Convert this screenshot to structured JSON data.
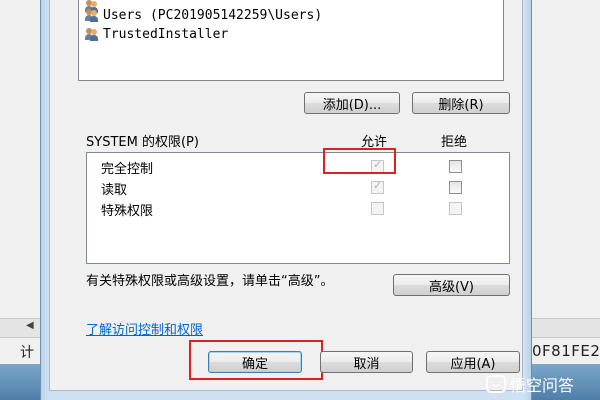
{
  "background": {
    "left_text": "计",
    "right_text": "0F81FE2"
  },
  "users": [
    {
      "name": "Users (PC201905142259\\Users)"
    },
    {
      "name": "TrustedInstaller"
    }
  ],
  "buttons": {
    "add": "添加(D)...",
    "remove": "删除(R)",
    "advanced": "高级(V)",
    "ok": "确定",
    "cancel": "取消",
    "apply": "应用(A)"
  },
  "permissions": {
    "title": "SYSTEM 的权限(P)",
    "allow_header": "允许",
    "deny_header": "拒绝",
    "rows": [
      {
        "label": "完全控制",
        "allow": true,
        "deny": false
      },
      {
        "label": "读取",
        "allow": true,
        "deny": false
      },
      {
        "label": "特殊权限",
        "allow": false,
        "deny": false
      }
    ]
  },
  "advanced_text": "有关特殊权限或高级设置，请单击“高级”。",
  "link_text": "了解访问控制和权限",
  "watermark": "悟空问答",
  "colors": {
    "highlight": "#e02020",
    "link": "#0066cc"
  }
}
